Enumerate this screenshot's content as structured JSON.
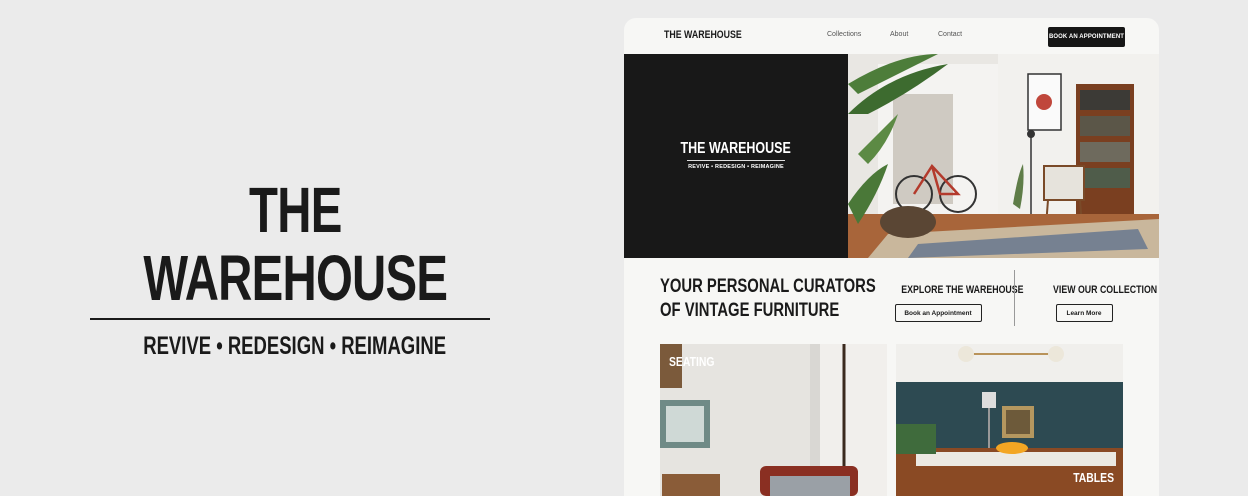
{
  "brand": {
    "title": "THE WAREHOUSE",
    "tagline": "REVIVE  •  REDESIGN  •  REIMAGINE"
  },
  "site": {
    "nav": {
      "logo": "THE WAREHOUSE",
      "links": [
        "Collections",
        "About",
        "Contact"
      ],
      "cta_label": "BOOK AN APPOINTMENT"
    },
    "hero": {
      "title": "THE WAREHOUSE",
      "tagline": "REVIVE  •  REDESIGN  •  REIMAGINE"
    },
    "intro": {
      "line1": "YOUR PERSONAL CURATORS",
      "line2": "OF VINTAGE FURNITURE"
    },
    "ctas": [
      {
        "title": "EXPLORE THE WAREHOUSE",
        "button": "Book an Appointment"
      },
      {
        "title": "VIEW OUR COLLECTION",
        "button": "Learn More"
      }
    ],
    "categories": [
      {
        "label": "SEATING"
      },
      {
        "label": "TABLES"
      }
    ]
  },
  "colors": {
    "page_bg": "#ebebeb",
    "site_bg": "#f7f7f5",
    "ink": "#1a1a1a",
    "hero_black": "#181818"
  }
}
